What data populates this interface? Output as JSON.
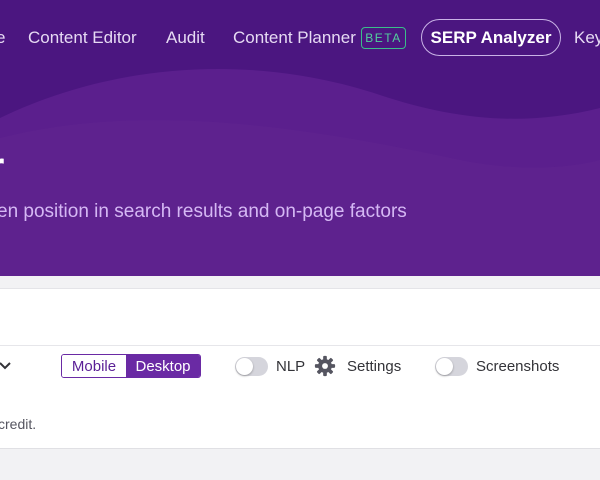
{
  "nav": {
    "items": [
      {
        "label": "e"
      },
      {
        "label": "Content Editor"
      },
      {
        "label": "Audit"
      },
      {
        "label": "Content Planner"
      },
      {
        "label": "SERP Analyzer"
      },
      {
        "label": "Key"
      }
    ],
    "beta_badge": "BETA"
  },
  "hero": {
    "title": "r",
    "subtitle": "en position in search results and on-page factors"
  },
  "search": {
    "keyword_value": "",
    "device_options": [
      "Mobile",
      "Desktop"
    ],
    "selected_device": "Desktop",
    "nlp_label": "NLP",
    "nlp_enabled": false,
    "settings_label": "Settings",
    "screenshots_label": "Screenshots",
    "screenshots_enabled": false,
    "credit_note": "credit."
  },
  "colors": {
    "hero_bg": "#4b1680",
    "accent": "#6a2aa4",
    "beta": "#52cf9c"
  },
  "icons": [
    "chevron-down-icon",
    "gear-icon"
  ]
}
